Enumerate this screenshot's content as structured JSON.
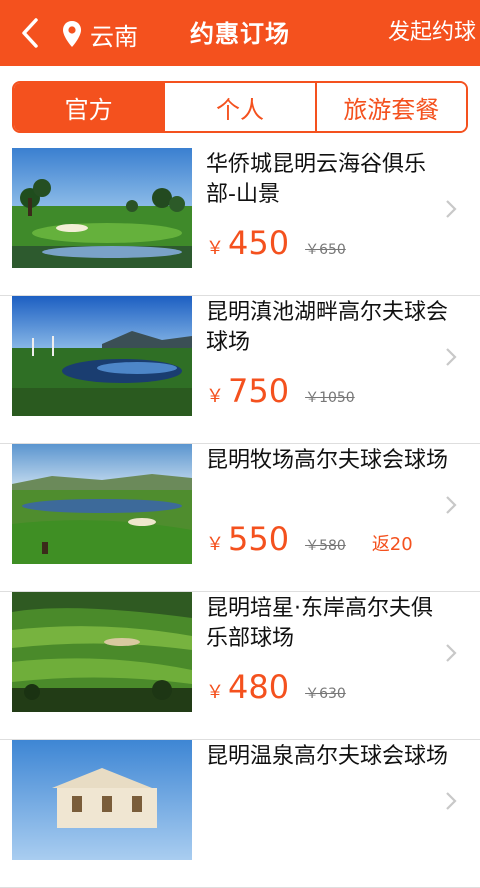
{
  "header": {
    "back_icon": "chevron-left-icon",
    "location_icon": "map-pin-icon",
    "location": "云南",
    "title": "约惠订场",
    "action": "发起约球"
  },
  "tabs": [
    {
      "label": "官方",
      "active": true
    },
    {
      "label": "个人",
      "active": false
    },
    {
      "label": "旅游套餐",
      "active": false
    }
  ],
  "currency_symbol": "￥",
  "courses": [
    {
      "name": "华侨城昆明云海谷俱乐部-山景",
      "price": "450",
      "original_price": "￥650",
      "rebate": ""
    },
    {
      "name": "昆明滇池湖畔高尔夫球会球场",
      "price": "750",
      "original_price": "￥1050",
      "rebate": ""
    },
    {
      "name": "昆明牧场高尔夫球会球场",
      "price": "550",
      "original_price": "￥580",
      "rebate": "返20"
    },
    {
      "name": "昆明培星·东岸高尔夫俱乐部球场",
      "price": "480",
      "original_price": "￥630",
      "rebate": ""
    },
    {
      "name": "昆明温泉高尔夫球会球场",
      "price": "",
      "original_price": "",
      "rebate": ""
    }
  ],
  "colors": {
    "accent": "#f4511e",
    "strike_price": "#777777",
    "divider": "#dedede"
  }
}
